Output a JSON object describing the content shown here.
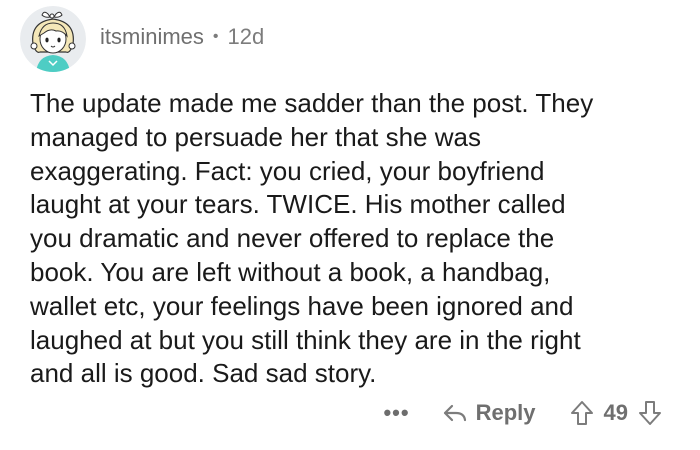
{
  "comment": {
    "author": "itsminimes",
    "separator": "•",
    "age": "12d",
    "text": "The update made me sadder than the post. They\nmanaged to persuade her that she was\nexaggerating. Fact: you cried, your boyfriend\nlaught at your tears. TWICE. His mother called\nyou dramatic and never offered to replace the\nbook. You are left without a book, a handbag,\nwallet etc, your feelings have been ignored and\nlaughed at but you still think they are in the right\nand all is good. Sad sad story.",
    "avatar_icon": "anime-girl-avatar-icon"
  },
  "actions": {
    "more_label": "•••",
    "more_icon": "more-options-icon",
    "reply_label": "Reply",
    "reply_icon": "reply-arrow-icon",
    "upvote_icon": "upvote-arrow-icon",
    "downvote_icon": "downvote-arrow-icon",
    "score": "49"
  },
  "colors": {
    "text": "#1a1a1a",
    "muted": "#7c7c7c",
    "avatar_bg": "#e9ecef",
    "shirt": "#4ecdc4"
  }
}
